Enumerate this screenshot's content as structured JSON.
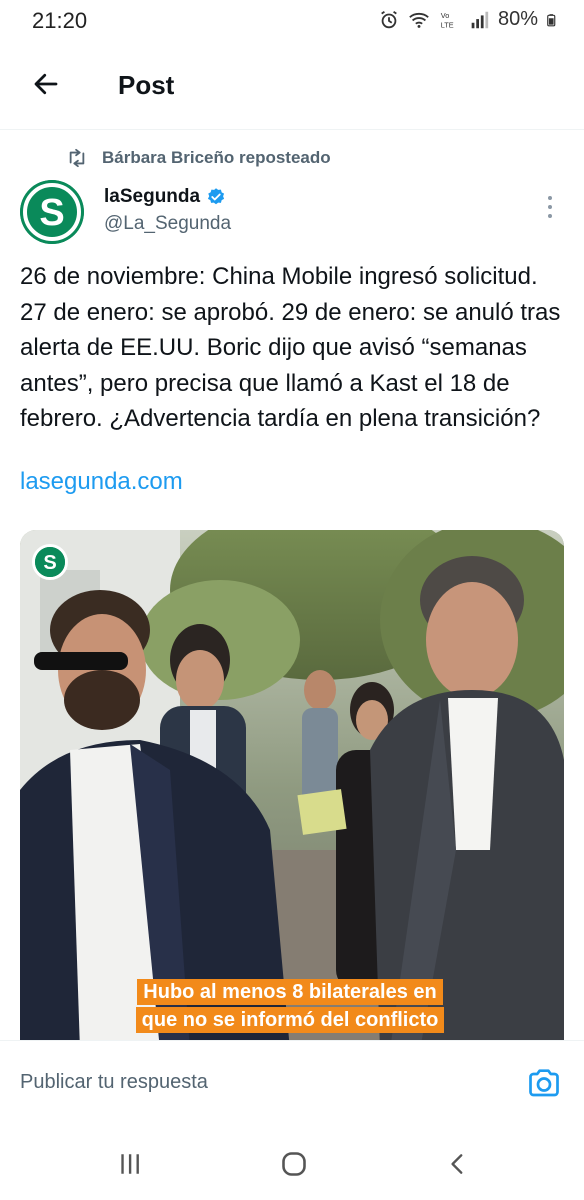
{
  "status_bar": {
    "time": "21:20",
    "battery": "80%",
    "icons": [
      "alarm-icon",
      "wifi-icon",
      "volte-icon",
      "signal-icon",
      "battery-icon"
    ]
  },
  "header": {
    "title": "Post",
    "back_icon": "arrow-left-icon"
  },
  "repost": {
    "text": "Bárbara Briceño reposteado",
    "icon": "repost-icon"
  },
  "author": {
    "name": "laSegunda",
    "handle": "@La_Segunda",
    "verified": true,
    "avatar_letter": "S",
    "brand_color": "#0a8a5a"
  },
  "tweet": {
    "text": "26 de noviembre: China Mobile ingresó solicitud. 27 de enero: se aprobó. 29 de enero: se anuló tras alerta de EE.UU. Boric dijo que avisó “semanas antes”, pero precisa que llamó a Kast el 18 de febrero. ¿Advertencia tardía en plena transición?",
    "link": "lasegunda.com"
  },
  "media": {
    "logo_letter": "S",
    "caption_line1": "Hubo al menos 8 bilaterales en",
    "caption_line2": "que no se informó del conflicto",
    "caption_color": "#f28a1a"
  },
  "reply": {
    "placeholder": "Publicar tu respuesta",
    "camera_icon": "camera-icon"
  },
  "colors": {
    "accent": "#1d9bf0",
    "muted": "#536471"
  },
  "nav": {
    "icons": [
      "recents-icon",
      "home-icon",
      "back-icon"
    ]
  }
}
